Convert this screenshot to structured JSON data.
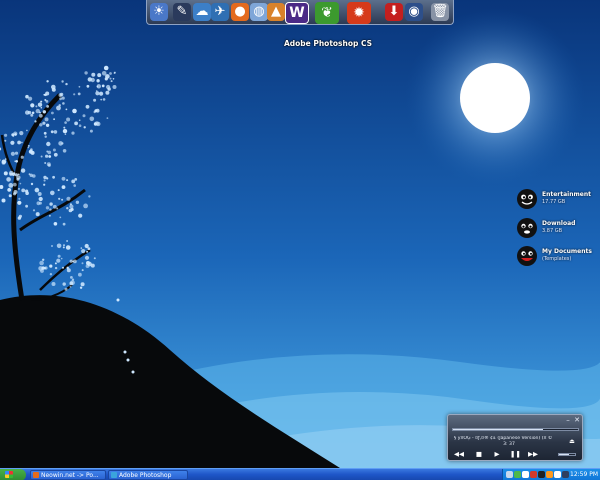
{
  "dock": {
    "hover_label": "Adobe Photoshop CS",
    "items": [
      {
        "name": "weather-icon",
        "glyph": "☀",
        "bg": "#4a78c8"
      },
      {
        "name": "tools-icon",
        "glyph": "✎",
        "bg": "#2a3a5c"
      },
      {
        "name": "network-icon",
        "glyph": "☁",
        "bg": "#3c7fc8"
      },
      {
        "name": "bird-icon",
        "glyph": "✈",
        "bg": "#2f6fb3"
      },
      {
        "name": "firefox-icon",
        "glyph": "●",
        "bg": "#e36a1e"
      },
      {
        "name": "globe-icon",
        "glyph": "◍",
        "bg": "#7fa6d8"
      },
      {
        "name": "vlc-icon",
        "glyph": "▲",
        "bg": "#d9822b"
      },
      {
        "name": "word-icon",
        "glyph": "W",
        "bg": "#4b2a86"
      },
      {
        "name": "photoshop-icon",
        "glyph": "❦",
        "bg": "#3c9a2e"
      },
      {
        "name": "fire-icon",
        "glyph": "✹",
        "bg": "#d63a1a"
      },
      {
        "name": "download-icon",
        "glyph": "⬇",
        "bg": "#c41f1f"
      },
      {
        "name": "media-icon",
        "glyph": "◉",
        "bg": "#2d4f8a"
      },
      {
        "name": "trash-icon",
        "glyph": "🗑",
        "bg": "#8893a6"
      }
    ]
  },
  "desktop": {
    "icons": [
      {
        "title": "Entertainment",
        "sub": "17.77 GB"
      },
      {
        "title": "Download",
        "sub": "3.87 GB"
      },
      {
        "title": "My Documents",
        "sub": "(Templates)"
      }
    ]
  },
  "player": {
    "track": "§ y¤ÕĢ - ¤ƒ,¤® ¢£ (Japanese Version) (¤ ©",
    "time": "3: 37",
    "progress": 0.72,
    "volume": 0.6,
    "controls": {
      "prev": "◀◀",
      "stop": "■",
      "play": "▶",
      "pause": "❚❚",
      "next": "▶▶"
    },
    "minimize": "–",
    "close": "✕",
    "eject": "⏏"
  },
  "taskbar": {
    "start_label": "",
    "tasks": [
      {
        "label": "Neowin.net -> Po...",
        "color": "#e46b1c"
      },
      {
        "label": "Adobe Photoshop",
        "color": "#3aa4dc"
      }
    ],
    "clock": "12:59 PM",
    "tray_colors": [
      "#c8d8ee",
      "#4fb84a",
      "#ffffff",
      "#d23a2a",
      "#222222",
      "#ff9a1f",
      "#ffffff",
      "#2f3f60"
    ]
  },
  "colors": {
    "sky_top": "#0b3d86",
    "sky_bottom": "#3c9be0",
    "hill": "#0a0d10",
    "moon": "#ffffff",
    "blossom": "#cfe8ff"
  }
}
